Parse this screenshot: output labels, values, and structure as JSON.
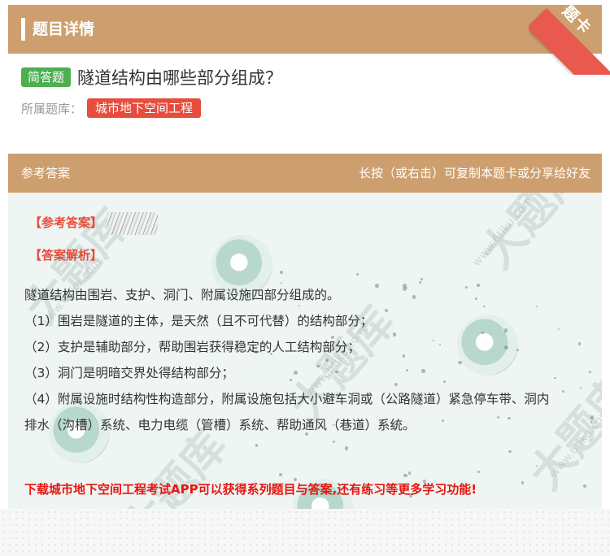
{
  "header": {
    "title": "题目详情",
    "ribbon": "题卡"
  },
  "question": {
    "type": "简答题",
    "title": "隧道结构由哪些部分组成？",
    "bank_label": "所属题库：",
    "bank_name": "城市地下空间工程"
  },
  "answer": {
    "section_label": "参考答案",
    "hint": "长按（或右击）可复制本题卡或分享给好友",
    "answer_tag": "【参考答案】",
    "analysis_tag": "【答案解析】",
    "lines": [
      "隧道结构由围岩、支护、洞门、附属设施四部分组成的。",
      "（1）围岩是隧道的主体，是天然（且不可代替）的结构部分；",
      "（2）支护是辅助部分，帮助围岩获得稳定的人工结构部分；",
      "（3）洞门是明暗交界处得结构部分；",
      "（4）附属设施时结构性构造部分，附属设施包括大小避车洞或（公路隧道）紧急停车带、洞内",
      "排水（沟槽）系统、电力电缆（管槽）系统、帮助通风（巷道）系统。"
    ],
    "download": "下载城市地下空间工程考试APP可以获得系列题目与答案,还有练习等更多学习功能!"
  },
  "watermark": {
    "big": "大题库",
    "small": "www.6tiku.com"
  },
  "colors": {
    "header": "#cd9f6e",
    "green_tag": "#4caf50",
    "red_tag": "#e74c3c",
    "answer_bg": "#eef5f3"
  }
}
